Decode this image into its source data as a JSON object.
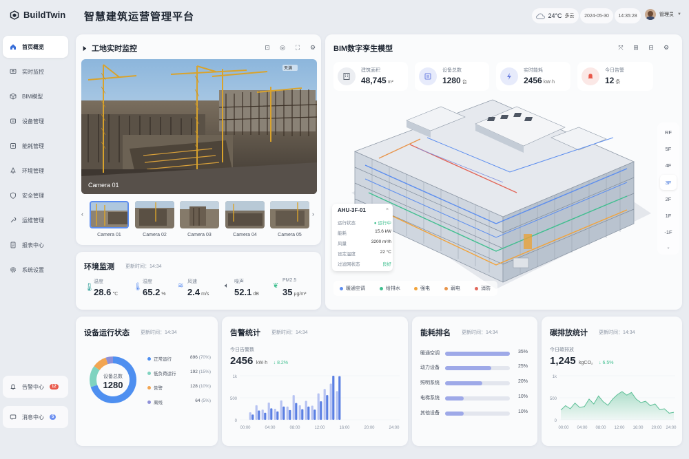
{
  "app": {
    "name": "BuildTwin",
    "title": "智慧建筑运营管理平台"
  },
  "header": {
    "weather": "24°C",
    "weather_desc": "多云",
    "date": "2024-05-30",
    "time": "14:35:28",
    "user": "管理员"
  },
  "sidebar": {
    "items": [
      {
        "label": "首页概览",
        "icon": "home-icon"
      },
      {
        "label": "实时监控",
        "icon": "monitor-icon"
      },
      {
        "label": "BIM模型",
        "icon": "cube-icon"
      },
      {
        "label": "设备管理",
        "icon": "device-icon"
      },
      {
        "label": "能耗管理",
        "icon": "energy-icon"
      },
      {
        "label": "环境管理",
        "icon": "environment-icon"
      },
      {
        "label": "安全管理",
        "icon": "shield-icon"
      },
      {
        "label": "运维管理",
        "icon": "wrench-icon"
      },
      {
        "label": "报表中心",
        "icon": "report-icon"
      },
      {
        "label": "系统设置",
        "icon": "gear-icon"
      }
    ],
    "alert": {
      "label": "告警中心",
      "count": "12"
    },
    "message": {
      "label": "消息中心",
      "count": "5"
    }
  },
  "camera": {
    "title": "工地实时监控",
    "weather_tag": "天满",
    "overlay": "Camera 01",
    "thumbs": [
      "Camera 01",
      "Camera 02",
      "Camera 03",
      "Camera 04",
      "Camera 05"
    ]
  },
  "env": {
    "title": "环境监测",
    "updated": "更新时间：14:34",
    "items": [
      {
        "label": "温度",
        "value": "28.6",
        "unit": "℃"
      },
      {
        "label": "湿度",
        "value": "65.2",
        "unit": "%"
      },
      {
        "label": "风速",
        "value": "2.4",
        "unit": "m/s"
      },
      {
        "label": "噪声",
        "value": "52.1",
        "unit": "dB"
      },
      {
        "label": "PM2.5",
        "value": "35",
        "unit": "μg/m³"
      }
    ]
  },
  "bim": {
    "title": "BIM数字孪生模型",
    "stats": [
      {
        "label": "建筑面积",
        "value": "48,745",
        "unit": "m²"
      },
      {
        "label": "设备总数",
        "value": "1280",
        "unit": "台"
      },
      {
        "label": "实时能耗",
        "value": "2456",
        "unit": "kW·h"
      },
      {
        "label": "今日告警",
        "value": "12",
        "unit": "条"
      }
    ],
    "floors": [
      "RF",
      "5F",
      "4F",
      "3F",
      "2F",
      "1F",
      "-1F"
    ],
    "selected_floor": "3F",
    "legend": [
      "暖通空调",
      "给排水",
      "强电",
      "弱电",
      "消防"
    ],
    "legend_colors": [
      "#5b8def",
      "#3fbf8f",
      "#f2a33a",
      "#e8944a",
      "#e2675a"
    ],
    "ahu": {
      "name": "AHU-3F-01",
      "rows": [
        {
          "k": "运行状态",
          "v": "● 运行中"
        },
        {
          "k": "能耗",
          "v": "15.6 kW"
        },
        {
          "k": "风量",
          "v": "3200 m³/h"
        },
        {
          "k": "设定温度",
          "v": "22 °C"
        },
        {
          "k": "过滤网状态",
          "v": "良好"
        }
      ]
    }
  },
  "device": {
    "title": "设备运行状态",
    "updated": "更新时间：14:34",
    "center_label": "设备总数",
    "total": "1280",
    "legend": [
      {
        "label": "正常运行",
        "count": "896",
        "pct": "(70%)",
        "color": "#4e8ff0"
      },
      {
        "label": "低负荷运行",
        "count": "192",
        "pct": "(15%)",
        "color": "#7fd3c0"
      },
      {
        "label": "告警",
        "count": "128",
        "pct": "(10%)",
        "color": "#f2a552"
      },
      {
        "label": "离线",
        "count": "64",
        "pct": "(5%)",
        "color": "#8e90d8"
      }
    ]
  },
  "alarm": {
    "title": "告警统计",
    "updated": "更新时间：14:34",
    "sub": "今日告警数",
    "value": "2456",
    "unit": "kW·h",
    "change": "↓ 8.2%",
    "y_ticks": [
      "1k",
      "500",
      "0"
    ],
    "x_ticks": [
      "00:00",
      "04:00",
      "08:00",
      "12:00",
      "16:00",
      "20:00",
      "24:00"
    ]
  },
  "rank": {
    "title": "能耗排名",
    "updated": "更新时间：14:34",
    "items": [
      {
        "label": "暖通空调",
        "pct": "35%",
        "value": 0.35
      },
      {
        "label": "动力设备",
        "pct": "25%",
        "value": 0.25
      },
      {
        "label": "照明系统",
        "pct": "20%",
        "value": 0.2
      },
      {
        "label": "电梯系统",
        "pct": "10%",
        "value": 0.1
      },
      {
        "label": "其他设备",
        "pct": "10%",
        "value": 0.1
      }
    ]
  },
  "carbon": {
    "title": "碳排放统计",
    "updated": "更新时间：14:34",
    "sub": "今日碳排放",
    "value": "1,245",
    "unit": "kgCO₂",
    "change": "↓ 6.5%",
    "y_ticks": [
      "1k",
      "500",
      "0"
    ],
    "x_ticks": [
      "00:00",
      "04:00",
      "08:00",
      "12:00",
      "16:00",
      "20:00",
      "24:00"
    ]
  },
  "chart_data": [
    {
      "type": "donut",
      "title": "设备运行状态",
      "categories": [
        "正常运行",
        "低负荷运行",
        "告警",
        "离线"
      ],
      "values": [
        896,
        192,
        128,
        64
      ]
    },
    {
      "type": "bar",
      "title": "告警统计",
      "ylim": [
        0,
        1000
      ],
      "x_range": [
        0,
        24
      ],
      "x": [
        0.8,
        1.8,
        2.8,
        3.8,
        4.8,
        5.8,
        6.8,
        7.8,
        8.8,
        9.8,
        10.8,
        11.8,
        12.8,
        13.8,
        14.8
      ],
      "values": [
        170,
        330,
        230,
        390,
        250,
        440,
        300,
        560,
        330,
        430,
        320,
        600,
        700,
        820,
        650
      ],
      "x2": [
        1.2,
        2.2,
        3.2,
        4.2,
        5.2,
        6.2,
        7.2,
        8.2,
        9.2,
        10.2,
        11.2,
        12.2,
        13.2,
        14.2,
        15.2
      ],
      "values2": [
        120,
        210,
        160,
        260,
        190,
        300,
        220,
        380,
        240,
        300,
        230,
        420,
        560,
        1000,
        990
      ]
    },
    {
      "type": "rank",
      "title": "能耗排名",
      "categories": [
        "暖通空调",
        "动力设备",
        "照明系统",
        "电梯系统",
        "其他设备"
      ],
      "values": [
        35,
        25,
        20,
        10,
        10
      ]
    },
    {
      "type": "area",
      "title": "碳排放统计",
      "ylim": [
        0,
        1000
      ],
      "x": [
        0,
        1,
        2,
        3,
        4,
        5,
        6,
        7,
        8,
        9,
        10,
        11,
        12,
        13,
        14,
        15,
        16,
        17,
        18,
        19,
        20,
        21,
        22,
        23,
        24
      ],
      "values": [
        220,
        320,
        250,
        380,
        280,
        300,
        470,
        360,
        540,
        410,
        330,
        470,
        570,
        640,
        560,
        620,
        470,
        390,
        420,
        320,
        360,
        230,
        250,
        150,
        170
      ]
    }
  ]
}
